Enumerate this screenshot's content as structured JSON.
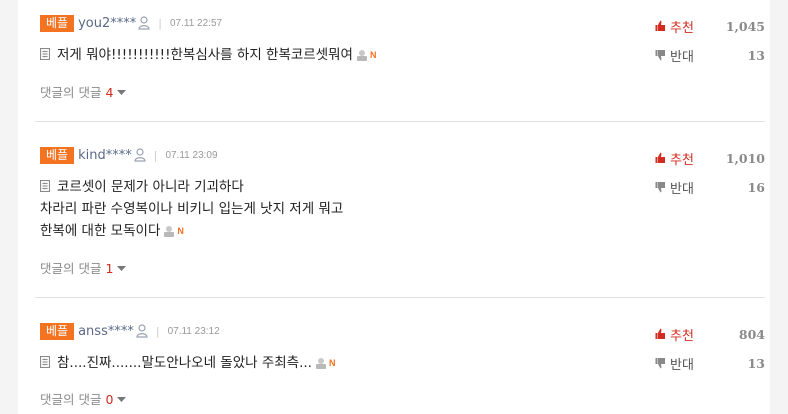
{
  "comments": [
    {
      "badge": "베플",
      "user": "you2****",
      "sep": "|",
      "time": "07.11 22:57",
      "lines": [
        "저게 뭐야!!!!!!!!!!!한복심사를 하지 한복코르셋뭐여"
      ],
      "reply_label": "댓글의 댓글",
      "reply_count": "4",
      "up_label": "추천",
      "up_count": "1,045",
      "down_label": "반대",
      "down_count": "13"
    },
    {
      "badge": "베플",
      "user": "kind****",
      "sep": "|",
      "time": "07.11 23:09",
      "lines": [
        "코르셋이 문제가 아니라 기괴하다",
        "차라리 파란 수영복이나 비키니 입는게 낫지 저게 뭐고",
        "한복에 대한 모독이다"
      ],
      "reply_label": "댓글의 댓글",
      "reply_count": "1",
      "up_label": "추천",
      "up_count": "1,010",
      "down_label": "반대",
      "down_count": "16"
    },
    {
      "badge": "베플",
      "user": "anss****",
      "sep": "|",
      "time": "07.11 23:12",
      "lines": [
        "참....진짜.......말도안나오네 돌았나 주최측..."
      ],
      "reply_label": "댓글의 댓글",
      "reply_count": "0",
      "up_label": "추천",
      "up_count": "804",
      "down_label": "반대",
      "down_count": "13"
    }
  ],
  "icons": {
    "user": "user-icon",
    "doc": "document-icon",
    "report": "report-icon",
    "new": "N",
    "up": "thumbs-up-icon",
    "down": "thumbs-down-icon",
    "caret": "caret-down-icon"
  },
  "colors": {
    "badge": "#f37321",
    "recommend": "#d12c1f",
    "reply_count": "#d12c1f",
    "username": "#5a6a86"
  }
}
